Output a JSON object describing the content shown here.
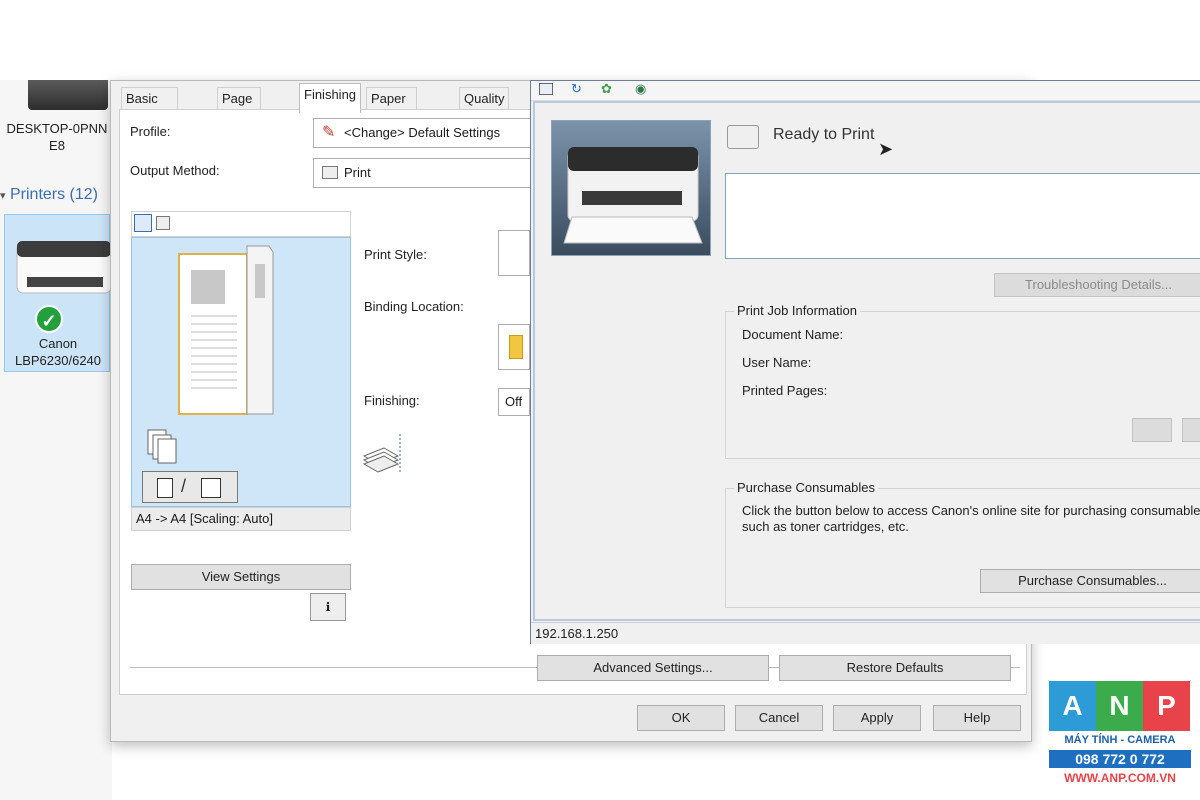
{
  "explorer": {
    "computer_name": "DESKTOP-0PNN E8",
    "printers_header": "Printers (12)",
    "printer_label_line1": "Canon",
    "printer_label_line2": "LBP6230/6240"
  },
  "prefs": {
    "tabs": [
      "Basic Settings",
      "Page Setup",
      "Finishing",
      "Paper Source",
      "Quality"
    ],
    "active_tab": "Finishing",
    "profile_label": "Profile:",
    "profile_value": "<Change> Default Settings",
    "output_method_label": "Output Method:",
    "output_method_value": "Print",
    "preview_caption": "A4 -> A4 [Scaling: Auto]",
    "view_settings": "View Settings",
    "print_style_label": "Print Style:",
    "binding_location_label": "Binding Location:",
    "finishing_label": "Finishing:",
    "finishing_value": "Off",
    "advanced_settings": "Advanced Settings...",
    "restore_defaults": "Restore Defaults",
    "ok": "OK",
    "cancel": "Cancel",
    "apply": "Apply",
    "help": "Help"
  },
  "status_window": {
    "status": "Ready to Print",
    "troubleshooting": "Troubleshooting Details...",
    "print_job_group": "Print Job Information",
    "document_name": "Document Name:",
    "user_name": "User Name:",
    "printed_pages": "Printed Pages:",
    "purchase_group": "Purchase Consumables",
    "purchase_text_1": "Click the button below to access Canon's online site for purchasing consumables",
    "purchase_text_2": "such as toner cartridges, etc.",
    "purchase_button": "Purchase Consumables...",
    "ip_address": "192.168.1.250"
  },
  "logo": {
    "letters": [
      "A",
      "N",
      "P"
    ],
    "tagline": "MÁY TÍNH - CAMERA",
    "phone": "098 772 0 772",
    "website": "WWW.ANP.COM.VN",
    "colors": {
      "a": "#2d9bd6",
      "n": "#3cab4c",
      "p": "#e8434a",
      "text": "#1e5fa8",
      "phone_bg": "#1e6fc0"
    }
  }
}
